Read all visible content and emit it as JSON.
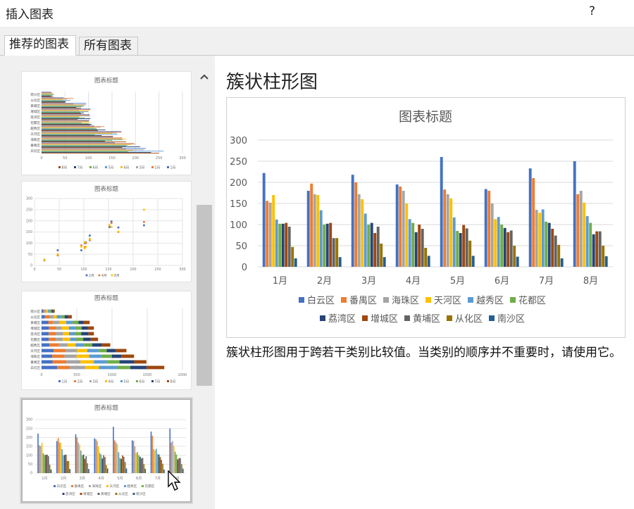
{
  "dialog": {
    "title": "插入图表",
    "help": "?"
  },
  "tabs": [
    {
      "label": "推荐的图表",
      "active": true
    },
    {
      "label": "所有图表",
      "active": false
    }
  ],
  "scrollbar": {
    "up_arrow": "^"
  },
  "colors": [
    "#4472c4",
    "#ed7d31",
    "#a5a5a5",
    "#ffc000",
    "#5b9bd5",
    "#70ad47",
    "#264478",
    "#9e480e",
    "#636363",
    "#997300",
    "#255e91"
  ],
  "thumbnails": [
    {
      "title": "图表标题",
      "kind": "clustered-bar",
      "categories": [
        "白云区",
        "番禺区",
        "海珠区",
        "天河区",
        "越秀区",
        "花都区",
        "荔湾区",
        "增城区",
        "黄埔区",
        "从化区",
        "南沙区"
      ],
      "series_names": [
        "8月",
        "7月",
        "6月",
        "5月",
        "4月",
        "3月",
        "2月",
        "1月"
      ],
      "xticks": [
        "0",
        "50",
        "100",
        "150",
        "200",
        "250",
        "300"
      ]
    },
    {
      "title": "图表标题",
      "kind": "scatter",
      "series_names": [
        "2月",
        "4月",
        "8月"
      ],
      "xticks": [
        "0",
        "50",
        "100",
        "150",
        "200",
        "250",
        "300"
      ],
      "yticks": [
        "0",
        "50",
        "100",
        "150",
        "200",
        "250",
        "300"
      ]
    },
    {
      "title": "图表标题",
      "kind": "stacked-bar",
      "categories": [
        "白云区",
        "番禺区",
        "海珠区",
        "天河区",
        "越秀区",
        "花都区",
        "荔湾区",
        "增城区",
        "黄埔区",
        "从化区",
        "南沙区"
      ],
      "series_names": [
        "1月",
        "2月",
        "3月",
        "4月",
        "5月",
        "6月",
        "7月",
        "8月"
      ],
      "xticks": [
        "0",
        "500",
        "1000",
        "1500",
        "2000"
      ]
    },
    {
      "title": "图表标题",
      "kind": "clustered-column",
      "selected": true,
      "months": [
        "1月",
        "2月",
        "3月",
        "4月",
        "5月",
        "6月",
        "7月",
        "8月"
      ],
      "yticks": [
        "0",
        "50",
        "100",
        "150",
        "200",
        "250",
        "300"
      ]
    }
  ],
  "preview": {
    "heading": "簇状柱形图",
    "description": "簇状柱形图用于跨若干类别比较值。当类别的顺序并不重要时，请使用它。"
  },
  "chart_data": {
    "type": "bar",
    "title": "图表标题",
    "categories": [
      "1月",
      "2月",
      "3月",
      "4月",
      "5月",
      "6月",
      "7月",
      "8月"
    ],
    "ylim": [
      0,
      300
    ],
    "yticks": [
      0,
      50,
      100,
      150,
      200,
      250,
      300
    ],
    "grid": true,
    "legend_position": "bottom",
    "series": [
      {
        "name": "白云区",
        "values": [
          222,
          180,
          218,
          195,
          260,
          184,
          233,
          250
        ]
      },
      {
        "name": "番禺区",
        "values": [
          156,
          197,
          200,
          190,
          183,
          180,
          210,
          172
        ]
      },
      {
        "name": "海珠区",
        "values": [
          152,
          172,
          172,
          180,
          172,
          150,
          135,
          180
        ]
      },
      {
        "name": "天河区",
        "values": [
          170,
          170,
          160,
          150,
          162,
          113,
          128,
          152
        ]
      },
      {
        "name": "越秀区",
        "values": [
          112,
          134,
          126,
          113,
          117,
          118,
          136,
          120
        ]
      },
      {
        "name": "花都区",
        "values": [
          102,
          100,
          100,
          104,
          85,
          100,
          107,
          104
        ]
      },
      {
        "name": "荔湾区",
        "values": [
          102,
          102,
          104,
          82,
          80,
          92,
          104,
          77
        ]
      },
      {
        "name": "增城区",
        "values": [
          104,
          104,
          80,
          100,
          99,
          82,
          90,
          84
        ]
      },
      {
        "name": "黄埔区",
        "values": [
          95,
          68,
          95,
          90,
          91,
          86,
          74,
          84
        ]
      },
      {
        "name": "从化区",
        "values": [
          47,
          68,
          55,
          45,
          62,
          50,
          52,
          50
        ]
      },
      {
        "name": "南沙区",
        "values": [
          20,
          23,
          23,
          26,
          26,
          24,
          20,
          25
        ]
      }
    ]
  }
}
